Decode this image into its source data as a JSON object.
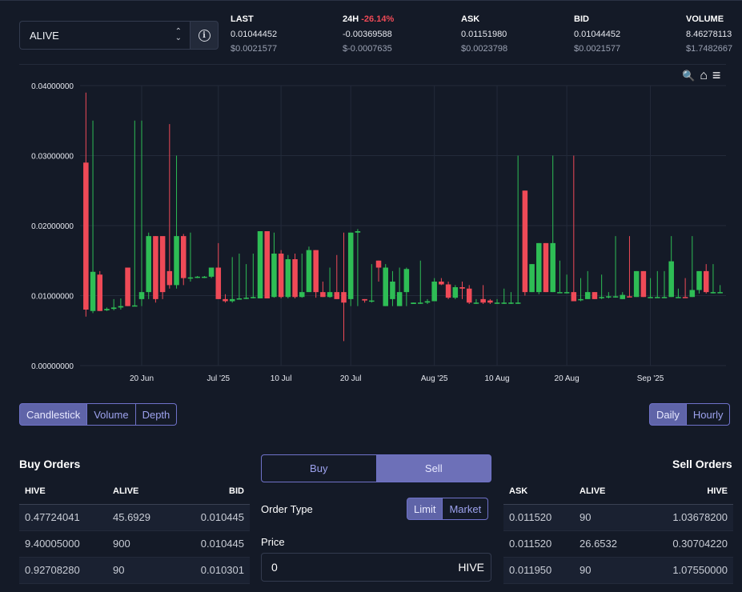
{
  "pair": {
    "selected": "ALIVE"
  },
  "stats": [
    {
      "label": "LAST",
      "change": "",
      "value": "0.01044452",
      "usd": "$0.0021577"
    },
    {
      "label": "24H",
      "change": "-26.14%",
      "value": "-0.00369588",
      "usd": "$-0.0007635"
    },
    {
      "label": "ASK",
      "change": "",
      "value": "0.01151980",
      "usd": "$0.0023798"
    },
    {
      "label": "BID",
      "change": "",
      "value": "0.01044452",
      "usd": "$0.0021577"
    },
    {
      "label": "VOLUME",
      "change": "",
      "value": "8.46278113",
      "usd": "$1.7482667"
    }
  ],
  "colors": {
    "up": "#2ebd55",
    "down": "#ef4a57",
    "accent": "#6f72c9",
    "bg": "#141a27"
  },
  "chart_data": {
    "type": "candlestick",
    "ylim": [
      0,
      0.04
    ],
    "yticks": [
      "0.00000000",
      "0.01000000",
      "0.02000000",
      "0.03000000",
      "0.04000000"
    ],
    "x_dates": [
      "2025-06-12",
      "2025-06-13",
      "2025-06-14",
      "2025-06-15",
      "2025-06-16",
      "2025-06-17",
      "2025-06-18",
      "2025-06-19",
      "2025-06-20",
      "2025-06-21",
      "2025-06-22",
      "2025-06-23",
      "2025-06-24",
      "2025-06-25",
      "2025-06-26",
      "2025-06-27",
      "2025-06-28",
      "2025-06-29",
      "2025-06-30",
      "2025-07-01",
      "2025-07-02",
      "2025-07-03",
      "2025-07-04",
      "2025-07-05",
      "2025-07-06",
      "2025-07-07",
      "2025-07-08",
      "2025-07-09",
      "2025-07-10",
      "2025-07-11",
      "2025-07-12",
      "2025-07-13",
      "2025-07-14",
      "2025-07-15",
      "2025-07-16",
      "2025-07-17",
      "2025-07-18",
      "2025-07-19",
      "2025-07-20",
      "2025-07-21",
      "2025-07-22",
      "2025-07-23",
      "2025-07-24",
      "2025-07-25",
      "2025-07-26",
      "2025-07-27",
      "2025-07-28",
      "2025-07-29",
      "2025-07-30",
      "2025-07-31",
      "2025-08-01",
      "2025-08-02",
      "2025-08-03",
      "2025-08-04",
      "2025-08-05",
      "2025-08-06",
      "2025-08-07",
      "2025-08-08",
      "2025-08-09",
      "2025-08-10",
      "2025-08-11",
      "2025-08-12",
      "2025-08-13",
      "2025-08-14",
      "2025-08-15",
      "2025-08-16",
      "2025-08-17",
      "2025-08-18",
      "2025-08-19",
      "2025-08-20",
      "2025-08-21",
      "2025-08-22",
      "2025-08-23",
      "2025-08-24",
      "2025-08-25",
      "2025-08-26",
      "2025-08-27",
      "2025-08-28",
      "2025-08-29",
      "2025-08-30",
      "2025-08-31",
      "2025-09-01",
      "2025-09-02",
      "2025-09-03",
      "2025-09-04",
      "2025-09-05",
      "2025-09-06",
      "2025-09-07",
      "2025-09-08",
      "2025-09-09",
      "2025-09-10",
      "2025-09-11"
    ],
    "x_tick_labels": [
      {
        "date": "2025-06-20",
        "label": "20 Jun"
      },
      {
        "date": "2025-07-01",
        "label": "Jul '25"
      },
      {
        "date": "2025-07-10",
        "label": "10 Jul"
      },
      {
        "date": "2025-07-20",
        "label": "20 Jul"
      },
      {
        "date": "2025-08-01",
        "label": "Aug '25"
      },
      {
        "date": "2025-08-10",
        "label": "10 Aug"
      },
      {
        "date": "2025-08-20",
        "label": "20 Aug"
      },
      {
        "date": "2025-09-01",
        "label": "Sep '25"
      }
    ],
    "candles": [
      [
        0.029,
        0.039,
        0.007,
        0.008
      ],
      [
        0.0078,
        0.035,
        0.0075,
        0.0134
      ],
      [
        0.013,
        0.0135,
        0.0078,
        0.0078
      ],
      [
        0.0079,
        0.0083,
        0.0078,
        0.0081
      ],
      [
        0.0081,
        0.0095,
        0.0079,
        0.0083
      ],
      [
        0.0083,
        0.0096,
        0.008,
        0.0085
      ],
      [
        0.014,
        0.014,
        0.0085,
        0.0085
      ],
      [
        0.0086,
        0.035,
        0.0085,
        0.0086
      ],
      [
        0.0095,
        0.035,
        0.0085,
        0.0105
      ],
      [
        0.0105,
        0.019,
        0.0095,
        0.0185
      ],
      [
        0.0185,
        0.0185,
        0.009,
        0.0095
      ],
      [
        0.0185,
        0.0183,
        0.0095,
        0.0105
      ],
      [
        0.0135,
        0.0345,
        0.011,
        0.0115
      ],
      [
        0.0115,
        0.03,
        0.011,
        0.0185
      ],
      [
        0.0185,
        0.0188,
        0.0115,
        0.0125
      ],
      [
        0.0125,
        0.019,
        0.012,
        0.0126
      ],
      [
        0.0126,
        0.0128,
        0.0125,
        0.0127
      ],
      [
        0.0126,
        0.0128,
        0.0125,
        0.0127
      ],
      [
        0.0127,
        0.014,
        0.0125,
        0.014
      ],
      [
        0.014,
        0.0175,
        0.0095,
        0.0095
      ],
      [
        0.0095,
        0.0102,
        0.009,
        0.0092
      ],
      [
        0.0092,
        0.0155,
        0.009,
        0.0095
      ],
      [
        0.0095,
        0.016,
        0.0095,
        0.0096
      ],
      [
        0.0096,
        0.0145,
        0.0095,
        0.0097
      ],
      [
        0.0097,
        0.016,
        0.0096,
        0.0098
      ],
      [
        0.0096,
        0.0192,
        0.0096,
        0.0192
      ],
      [
        0.0192,
        0.0192,
        0.0096,
        0.0096
      ],
      [
        0.0098,
        0.019,
        0.0097,
        0.016
      ],
      [
        0.016,
        0.0165,
        0.0096,
        0.0098
      ],
      [
        0.0098,
        0.0158,
        0.0096,
        0.0152
      ],
      [
        0.0152,
        0.016,
        0.0096,
        0.0098
      ],
      [
        0.0098,
        0.016,
        0.0097,
        0.0105
      ],
      [
        0.0105,
        0.017,
        0.0105,
        0.0165
      ],
      [
        0.0165,
        0.0165,
        0.0097,
        0.0105
      ],
      [
        0.0105,
        0.012,
        0.0098,
        0.0098
      ],
      [
        0.0098,
        0.014,
        0.0097,
        0.0105
      ],
      [
        0.0105,
        0.0158,
        0.0095,
        0.0095
      ],
      [
        0.0105,
        0.019,
        0.0035,
        0.009
      ],
      [
        0.0095,
        0.019,
        0.0085,
        0.019
      ],
      [
        0.019,
        0.0195,
        0.0085,
        0.0192
      ],
      [
        0.0095,
        0.0095,
        0.009,
        0.0093
      ],
      [
        0.0093,
        0.0145,
        0.009,
        0.0093
      ],
      [
        0.015,
        0.015,
        0.012,
        0.014
      ],
      [
        0.0085,
        0.0145,
        0.0085,
        0.014
      ],
      [
        0.0095,
        0.0135,
        0.0085,
        0.012
      ],
      [
        0.0085,
        0.014,
        0.0085,
        0.0105
      ],
      [
        0.0105,
        0.014,
        0.0085,
        0.0138
      ],
      [
        0.0088,
        0.009,
        0.0088,
        0.009
      ],
      [
        0.009,
        0.015,
        0.0088,
        0.009
      ],
      [
        0.009,
        0.0095,
        0.0088,
        0.0092
      ],
      [
        0.0092,
        0.0125,
        0.0092,
        0.012
      ],
      [
        0.012,
        0.0125,
        0.0115,
        0.0116
      ],
      [
        0.0116,
        0.012,
        0.0095,
        0.0097
      ],
      [
        0.0097,
        0.0115,
        0.0095,
        0.0112
      ],
      [
        0.0112,
        0.012,
        0.0095,
        0.011
      ],
      [
        0.011,
        0.0115,
        0.0088,
        0.009
      ],
      [
        0.009,
        0.0095,
        0.0088,
        0.009
      ],
      [
        0.0095,
        0.0115,
        0.0088,
        0.009
      ],
      [
        0.0093,
        0.0095,
        0.0088,
        0.009
      ],
      [
        0.009,
        0.0095,
        0.0088,
        0.009
      ],
      [
        0.009,
        0.011,
        0.0088,
        0.009
      ],
      [
        0.009,
        0.0105,
        0.0088,
        0.009
      ],
      [
        0.009,
        0.03,
        0.0088,
        0.009
      ],
      [
        0.025,
        0.025,
        0.01,
        0.0105
      ],
      [
        0.0105,
        0.0145,
        0.0105,
        0.0145
      ],
      [
        0.0105,
        0.0175,
        0.0102,
        0.0175
      ],
      [
        0.0175,
        0.0175,
        0.0105,
        0.0105
      ],
      [
        0.0105,
        0.03,
        0.0105,
        0.0175
      ],
      [
        0.0105,
        0.015,
        0.0105,
        0.0105
      ],
      [
        0.0105,
        0.013,
        0.0103,
        0.0105
      ],
      [
        0.0105,
        0.03,
        0.0092,
        0.0092
      ],
      [
        0.0095,
        0.0125,
        0.0092,
        0.0095
      ],
      [
        0.0095,
        0.0135,
        0.0095,
        0.0105
      ],
      [
        0.0105,
        0.0105,
        0.0095,
        0.0095
      ],
      [
        0.0097,
        0.013,
        0.0095,
        0.0098
      ],
      [
        0.0098,
        0.0105,
        0.0096,
        0.0099
      ],
      [
        0.0099,
        0.0185,
        0.0097,
        0.0099
      ],
      [
        0.0095,
        0.0105,
        0.0095,
        0.0101
      ],
      [
        0.0099,
        0.0185,
        0.0098,
        0.0098
      ],
      [
        0.0098,
        0.0135,
        0.0098,
        0.0135
      ],
      [
        0.0135,
        0.0135,
        0.0098,
        0.0098
      ],
      [
        0.0098,
        0.0125,
        0.0097,
        0.0098
      ],
      [
        0.0098,
        0.0135,
        0.0097,
        0.0098
      ],
      [
        0.0098,
        0.0135,
        0.0097,
        0.0098
      ],
      [
        0.0098,
        0.0185,
        0.0098,
        0.0149
      ],
      [
        0.0097,
        0.011,
        0.0097,
        0.0098
      ],
      [
        0.0098,
        0.0125,
        0.0098,
        0.0097
      ],
      [
        0.0098,
        0.0185,
        0.0098,
        0.0108
      ],
      [
        0.0108,
        0.013,
        0.0103,
        0.0135
      ],
      [
        0.0135,
        0.0145,
        0.0103,
        0.0105
      ],
      [
        0.0105,
        0.0145,
        0.0103,
        0.0105
      ],
      [
        0.0105,
        0.0115,
        0.0104,
        0.0105
      ]
    ]
  },
  "chart_tools": {
    "zoom": "🔍",
    "home": "⌂",
    "menu": "≡"
  },
  "chart_modes": [
    "Candlestick",
    "Volume",
    "Depth"
  ],
  "intervals": [
    "Daily",
    "Hourly"
  ],
  "buy_orders": {
    "title": "Buy Orders",
    "columns": [
      "HIVE",
      "ALIVE",
      "BID"
    ],
    "rows": [
      [
        "0.47724041",
        "45.6929",
        "0.010445"
      ],
      [
        "9.40005000",
        "900",
        "0.010445"
      ],
      [
        "0.92708280",
        "90",
        "0.010301"
      ]
    ]
  },
  "sell_orders": {
    "title": "Sell Orders",
    "columns": [
      "ASK",
      "ALIVE",
      "HIVE"
    ],
    "rows": [
      [
        "0.011520",
        "90",
        "1.03678200"
      ],
      [
        "0.011520",
        "26.6532",
        "0.30704220"
      ],
      [
        "0.011950",
        "90",
        "1.07550000"
      ]
    ]
  },
  "trade_form": {
    "buy_label": "Buy",
    "sell_label": "Sell",
    "order_type_label": "Order Type",
    "limit_label": "Limit",
    "market_label": "Market",
    "price_label": "Price",
    "price_value": "0",
    "price_unit": "HIVE"
  }
}
